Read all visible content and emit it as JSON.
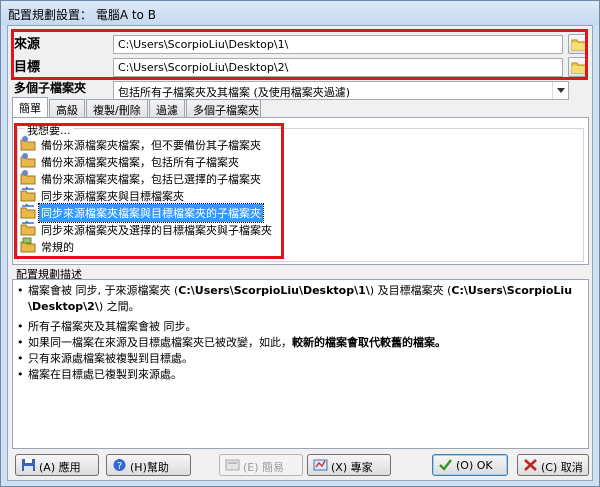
{
  "window": {
    "title": "配置規劃設置： 電腦A to B"
  },
  "paths": {
    "source_label": "來源",
    "source_value": "C:\\Users\\ScorpioLiu\\Desktop\\1\\",
    "target_label": "目標",
    "target_value": "C:\\Users\\ScorpioLiu\\Desktop\\2\\"
  },
  "subfolders": {
    "label": "多個子檔案夾",
    "selected": "包括所有子檔案夾及其檔案 (及使用檔案夾過濾)"
  },
  "tabs": [
    "簡單",
    "高級",
    "複製/刪除",
    "過濾",
    "多個子檔案夾"
  ],
  "panel": {
    "legend": "我想要...",
    "items": [
      "備份來源檔案夾檔案，但不要備份其子檔案夾",
      "備份來源檔案夾檔案，包括所有子檔案夾",
      "備份來源檔案夾檔案，包括已選擇的子檔案夾",
      "同步來源檔案夾與目標檔案夾",
      "同步來源檔案夾檔案與目標檔案夾的子檔案夾",
      "同步來源檔案夾及選擇的目標檔案夾與子檔案夾",
      "常規的"
    ],
    "selected_index": 4
  },
  "description": {
    "legend": "配置規劃描述",
    "line1a": "檔案會被 同步, 于來源檔案夾 (",
    "line1b": "C:\\Users\\ScorpioLiu\\Desktop\\1\\",
    "line1c": ") 及目標檔案夾 (",
    "line1d": "C:\\Users\\ScorpioLiu",
    "line2a": "\\Desktop\\2\\",
    "line2b": ") 之間。",
    "b2": "所有子檔案夾及其檔案會被 同步。",
    "b3a": "如果同一檔案在來源及目標處檔案夾已被改變，如此，",
    "b3b": "較新的檔案會取代較舊的檔案。",
    "b4": "只有來源處檔案被複製到目標處。",
    "b5": "檔案在目標處已複製到來源處。",
    "bullet": "•"
  },
  "buttons": {
    "apply": "(A) 應用",
    "help": "(H)幫助",
    "simple": "(E) 簡易",
    "expert": "(X) 專家",
    "ok": "(O) OK",
    "cancel": "(C) 取消"
  },
  "colors": {
    "highlight_box": "#e0141d",
    "selection": "#3399ff"
  }
}
